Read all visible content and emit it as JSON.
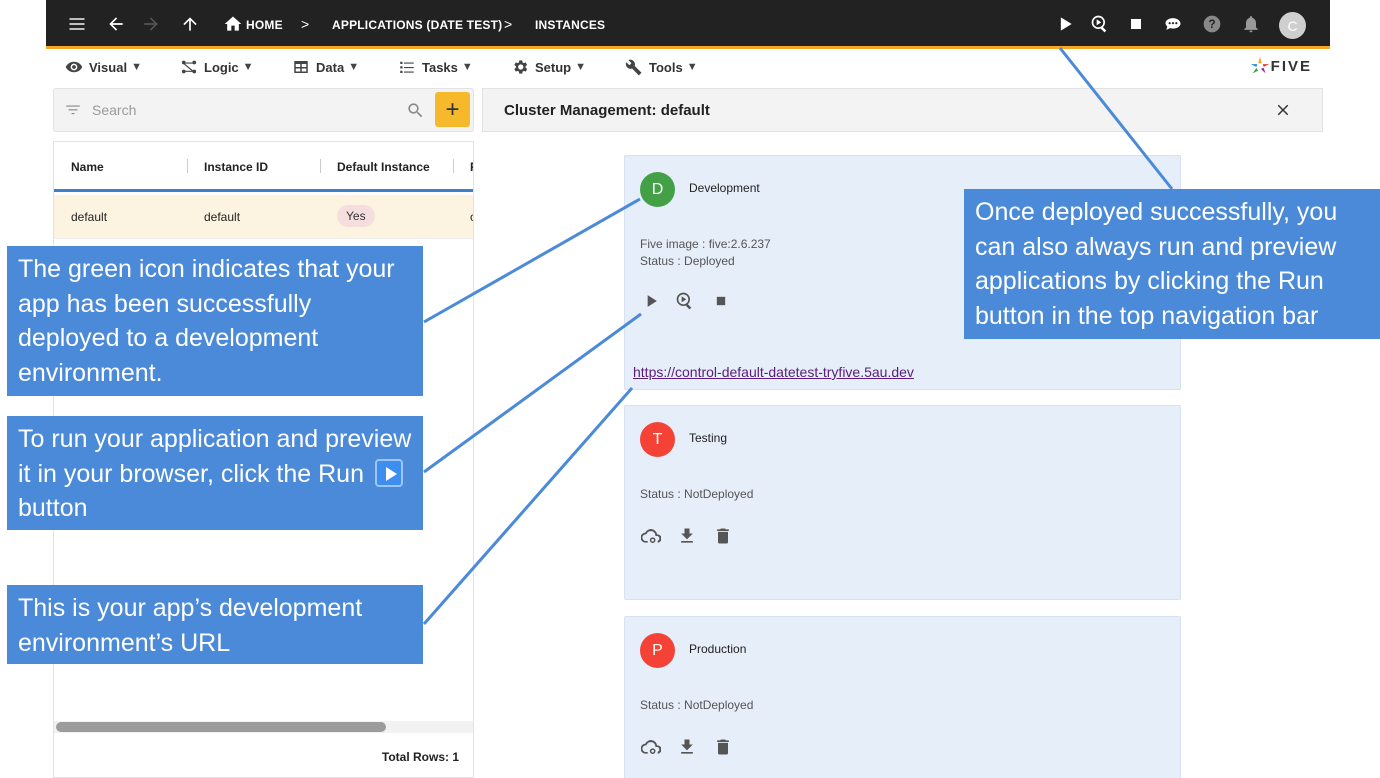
{
  "breadcrumb": {
    "home": "HOME",
    "separator": ">",
    "app": "APPLICATIONS (DATE TEST)",
    "instances": "INSTANCES"
  },
  "topbar": {
    "avatar_letter": "C",
    "icons": [
      "menu-icon",
      "back-arrow-icon",
      "forward-arrow-icon",
      "up-arrow-icon",
      "home-icon",
      "play-icon",
      "run-preview-icon",
      "stop-icon",
      "chat-icon",
      "help-icon",
      "bell-icon"
    ]
  },
  "menu": {
    "items": [
      {
        "label": "Visual",
        "icon": "eye-icon"
      },
      {
        "label": "Logic",
        "icon": "logic-icon"
      },
      {
        "label": "Data",
        "icon": "table-icon"
      },
      {
        "label": "Tasks",
        "icon": "tasks-icon"
      },
      {
        "label": "Setup",
        "icon": "gear-icon"
      },
      {
        "label": "Tools",
        "icon": "tools-icon"
      }
    ],
    "caret": "▼",
    "logo": "FIVE"
  },
  "search": {
    "placeholder": "Search",
    "add_label": "+"
  },
  "grid": {
    "columns": [
      "Name",
      "Instance ID",
      "Default Instance",
      "F"
    ],
    "rows": [
      {
        "name": "default",
        "instance_id": "default",
        "default_instance": "Yes",
        "extra": "c"
      }
    ],
    "total_rows": "Total Rows: 1"
  },
  "cluster": {
    "title": "Cluster Management: default",
    "cards": [
      {
        "letter": "D",
        "name": "Development",
        "color": "#43a047",
        "image": "Five image : five:2.6.237",
        "status": "Status : Deployed",
        "url": "https://control-default-datetest-tryfive.5au.dev"
      },
      {
        "letter": "T",
        "name": "Testing",
        "color": "#f44336",
        "status": "Status : NotDeployed"
      },
      {
        "letter": "P",
        "name": "Production",
        "color": "#f44336",
        "status": "Status : NotDeployed"
      }
    ]
  },
  "callouts": {
    "top_right": "Once deployed successfully, you can also always run and preview applications by clicking the Run button in the top navigation bar",
    "green_icon": "The green icon indicates that your app has been successfully deployed to a development environment.",
    "run_pre": "To run your application and preview it in your browser, click the Run",
    "run_post": "button",
    "url": "This is your app’s  development environment’s URL"
  },
  "colors": {
    "accent": "#f5a623",
    "callout": "#4a8ad8",
    "selected_row": "#fdf3e1",
    "card_bg": "#e6eefa"
  }
}
